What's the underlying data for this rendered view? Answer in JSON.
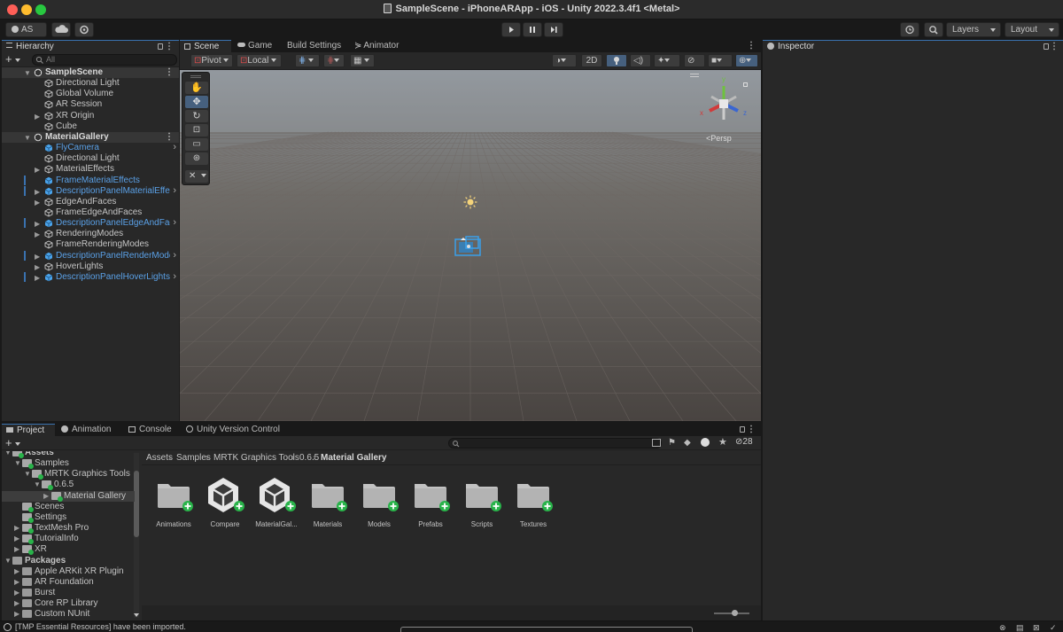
{
  "window": {
    "title": "SampleScene - iPhoneARApp - iOS - Unity 2022.3.4f1 <Metal>"
  },
  "toolbar": {
    "account": "AS",
    "layers": "Layers",
    "layout": "Layout"
  },
  "hierarchy": {
    "tab": "Hierarchy",
    "search_placeholder": "All",
    "rows": [
      {
        "label": "SampleScene"
      },
      {
        "label": "Directional Light"
      },
      {
        "label": "Global Volume"
      },
      {
        "label": "AR Session"
      },
      {
        "label": "XR Origin"
      },
      {
        "label": "Cube"
      },
      {
        "label": "MaterialGallery"
      },
      {
        "label": "FlyCamera"
      },
      {
        "label": "Directional Light"
      },
      {
        "label": "MaterialEffects"
      },
      {
        "label": "FrameMaterialEffects"
      },
      {
        "label": "DescriptionPanelMaterialEffec"
      },
      {
        "label": "EdgeAndFaces"
      },
      {
        "label": "FrameEdgeAndFaces"
      },
      {
        "label": "DescriptionPanelEdgeAndFac"
      },
      {
        "label": "RenderingModes"
      },
      {
        "label": "FrameRenderingModes"
      },
      {
        "label": "DescriptionPanelRenderMode"
      },
      {
        "label": "HoverLights"
      },
      {
        "label": "DescriptionPanelHoverLights"
      }
    ]
  },
  "scene_tabs": [
    "Scene",
    "Game",
    "Build Settings",
    "Animator"
  ],
  "scene_toolbar": {
    "pivot": "Pivot",
    "local": "Local",
    "mode_2d": "2D",
    "persp": "Persp",
    "gizmo_x": "x",
    "gizmo_y": "y",
    "gizmo_z": "z"
  },
  "inspector": {
    "tab": "Inspector"
  },
  "project": {
    "tabs": [
      "Project",
      "Animation",
      "Console",
      "Unity Version Control"
    ],
    "hidden_count": "28",
    "tree": [
      {
        "label": "Assets"
      },
      {
        "label": "Samples"
      },
      {
        "label": "MRTK Graphics Tools"
      },
      {
        "label": "0.6.5"
      },
      {
        "label": "Material Gallery"
      },
      {
        "label": "Scenes"
      },
      {
        "label": "Settings"
      },
      {
        "label": "TextMesh Pro"
      },
      {
        "label": "TutorialInfo"
      },
      {
        "label": "XR"
      },
      {
        "label": "Packages"
      },
      {
        "label": "Apple ARKit XR Plugin"
      },
      {
        "label": "AR Foundation"
      },
      {
        "label": "Burst"
      },
      {
        "label": "Core RP Library"
      },
      {
        "label": "Custom NUnit"
      }
    ],
    "breadcrumb": [
      "Assets",
      "Samples",
      "MRTK Graphics Tools",
      "0.6.5",
      "Material Gallery"
    ],
    "assets": [
      {
        "name": "Animations",
        "icon": "folder-icon"
      },
      {
        "name": "Compare",
        "icon": "unity-scene-icon"
      },
      {
        "name": "MaterialGal...",
        "icon": "unity-scene-icon"
      },
      {
        "name": "Materials",
        "icon": "folder-icon"
      },
      {
        "name": "Models",
        "icon": "folder-icon"
      },
      {
        "name": "Prefabs",
        "icon": "folder-icon"
      },
      {
        "name": "Scripts",
        "icon": "folder-icon"
      },
      {
        "name": "Textures",
        "icon": "folder-icon"
      }
    ]
  },
  "status": {
    "message": "[TMP Essential Resources] have been imported."
  },
  "colors": {
    "accent": "#3a72b0",
    "selection_blue": "#5aa0e6",
    "badge_green": "#29b34a"
  }
}
